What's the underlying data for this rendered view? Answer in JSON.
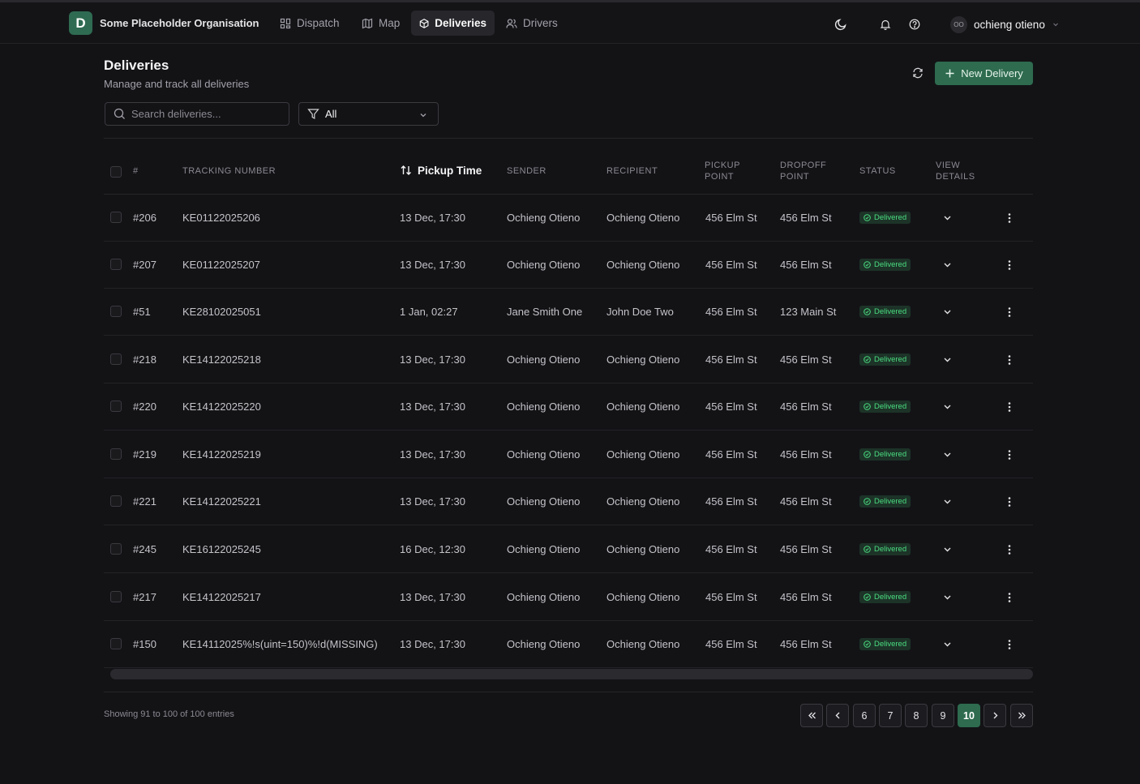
{
  "org": {
    "logo_letter": "D",
    "name": "Some Placeholder Organisation"
  },
  "nav": [
    {
      "label": "Dispatch",
      "icon": "grid-icon",
      "active": false
    },
    {
      "label": "Map",
      "icon": "map-icon",
      "active": false
    },
    {
      "label": "Deliveries",
      "icon": "package-icon",
      "active": true
    },
    {
      "label": "Drivers",
      "icon": "users-icon",
      "active": false
    }
  ],
  "user": {
    "initials": "OO",
    "name": "ochieng otieno"
  },
  "page": {
    "title": "Deliveries",
    "subtitle": "Manage and track all deliveries",
    "new_button": "New Delivery"
  },
  "search": {
    "placeholder": "Search deliveries..."
  },
  "filter": {
    "value": "All"
  },
  "table": {
    "headers": {
      "num": "#",
      "tracking": "TRACKING NUMBER",
      "pickup_time": "Pickup Time",
      "sender": "SENDER",
      "recipient": "RECIPIENT",
      "pickup_point_1": "PICKUP",
      "pickup_point_2": "POINT",
      "dropoff_point_1": "DROPOFF",
      "dropoff_point_2": "POINT",
      "status": "STATUS",
      "view_1": "VIEW",
      "view_2": "DETAILS"
    },
    "rows": [
      {
        "num": "#206",
        "tracking": "KE01122025206",
        "time": "13 Dec, 17:30",
        "sender": "Ochieng Otieno",
        "recipient": "Ochieng Otieno",
        "pickup": "456 Elm St",
        "dropoff": "456 Elm St",
        "status": "Delivered"
      },
      {
        "num": "#207",
        "tracking": "KE01122025207",
        "time": "13 Dec, 17:30",
        "sender": "Ochieng Otieno",
        "recipient": "Ochieng Otieno",
        "pickup": "456 Elm St",
        "dropoff": "456 Elm St",
        "status": "Delivered"
      },
      {
        "num": "#51",
        "tracking": "KE28102025051",
        "time": "1 Jan, 02:27",
        "sender": "Jane Smith One",
        "recipient": "John Doe Two",
        "pickup": "456 Elm St",
        "dropoff": "123 Main St",
        "status": "Delivered"
      },
      {
        "num": "#218",
        "tracking": "KE14122025218",
        "time": "13 Dec, 17:30",
        "sender": "Ochieng Otieno",
        "recipient": "Ochieng Otieno",
        "pickup": "456 Elm St",
        "dropoff": "456 Elm St",
        "status": "Delivered"
      },
      {
        "num": "#220",
        "tracking": "KE14122025220",
        "time": "13 Dec, 17:30",
        "sender": "Ochieng Otieno",
        "recipient": "Ochieng Otieno",
        "pickup": "456 Elm St",
        "dropoff": "456 Elm St",
        "status": "Delivered"
      },
      {
        "num": "#219",
        "tracking": "KE14122025219",
        "time": "13 Dec, 17:30",
        "sender": "Ochieng Otieno",
        "recipient": "Ochieng Otieno",
        "pickup": "456 Elm St",
        "dropoff": "456 Elm St",
        "status": "Delivered"
      },
      {
        "num": "#221",
        "tracking": "KE14122025221",
        "time": "13 Dec, 17:30",
        "sender": "Ochieng Otieno",
        "recipient": "Ochieng Otieno",
        "pickup": "456 Elm St",
        "dropoff": "456 Elm St",
        "status": "Delivered"
      },
      {
        "num": "#245",
        "tracking": "KE16122025245",
        "time": "16 Dec, 12:30",
        "sender": "Ochieng Otieno",
        "recipient": "Ochieng Otieno",
        "pickup": "456 Elm St",
        "dropoff": "456 Elm St",
        "status": "Delivered"
      },
      {
        "num": "#217",
        "tracking": "KE14122025217",
        "time": "13 Dec, 17:30",
        "sender": "Ochieng Otieno",
        "recipient": "Ochieng Otieno",
        "pickup": "456 Elm St",
        "dropoff": "456 Elm St",
        "status": "Delivered"
      },
      {
        "num": "#150",
        "tracking": "KE14112025%!s(uint=150)%!d(MISSING)",
        "time": "13 Dec, 17:30",
        "sender": "Ochieng Otieno",
        "recipient": "Ochieng Otieno",
        "pickup": "456 Elm St",
        "dropoff": "456 Elm St",
        "status": "Delivered"
      }
    ]
  },
  "footer": {
    "summary": "Showing 91 to 100 of 100 entries",
    "pages": [
      "6",
      "7",
      "8",
      "9",
      "10"
    ],
    "current_page": "10"
  },
  "colors": {
    "accent": "#2e6b4f",
    "status_green": "#4ade80",
    "background": "#131316"
  }
}
